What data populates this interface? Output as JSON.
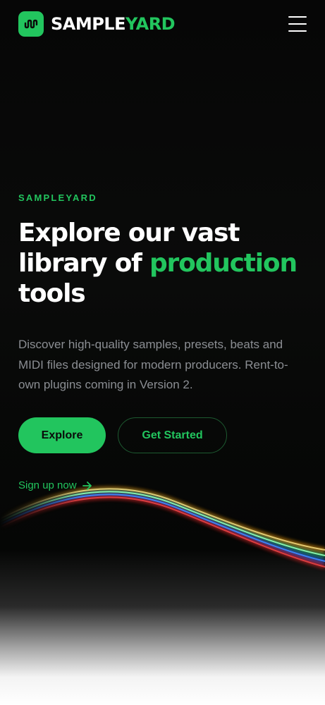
{
  "header": {
    "brand_primary": "SAMPLE",
    "brand_accent": "YARD",
    "logo_icon": "waveform-icon",
    "menu_icon": "hamburger-menu-icon"
  },
  "hero": {
    "eyebrow": "SAMPLEYARD",
    "headline_part1": "Explore our vast library of ",
    "headline_accent": "production",
    "headline_part2": " tools",
    "description": "Discover high-quality samples, presets, beats and MIDI files designed for modern producers. Rent-to-own plugins coming in Version 2."
  },
  "actions": {
    "explore_label": "Explore",
    "get_started_label": "Get Started",
    "signup_label": "Sign up now",
    "signup_icon": "arrow-right-icon"
  },
  "colors": {
    "accent": "#22c55e",
    "background": "#050505",
    "text_primary": "#ffffff",
    "text_muted": "#8b8e93"
  }
}
